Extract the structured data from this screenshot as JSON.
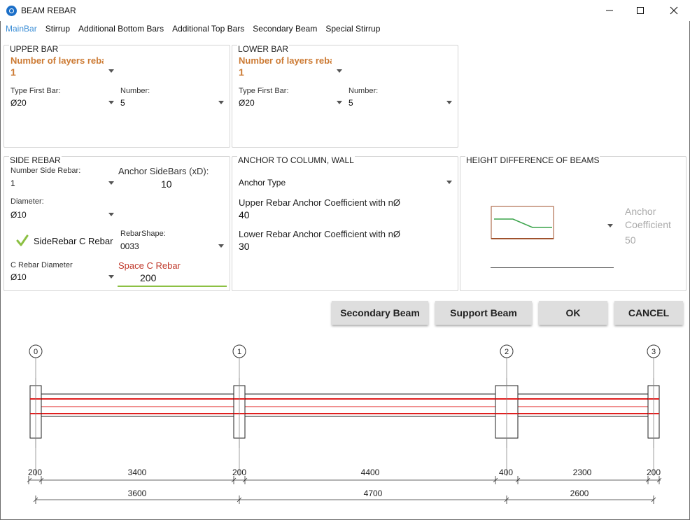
{
  "window": {
    "title": "BEAM REBAR",
    "minimize": "—",
    "maximize": "☐",
    "close": "✕"
  },
  "tabs": [
    "MainBar",
    "Stirrup",
    "Additional Bottom Bars",
    "Additional Top Bars",
    "Secondary Beam",
    "Special Stirrup"
  ],
  "upper_bar": {
    "title": "UPPER BAR",
    "layers_label": "Number of layers rebar",
    "layers_value": "1",
    "type_first_bar_label": "Type First Bar:",
    "type_first_bar_value": "Ø20",
    "number_label": "Number:",
    "number_value": "5"
  },
  "lower_bar": {
    "title": "LOWER BAR",
    "layers_label": "Number of layers rebar",
    "layers_value": "1",
    "type_first_bar_label": "Type First Bar:",
    "type_first_bar_value": "Ø20",
    "number_label": "Number:",
    "number_value": "5"
  },
  "side_rebar": {
    "title": "SIDE REBAR",
    "number_label": "Number Side Rebar:",
    "number_value": "1",
    "anchor_label": "Anchor SideBars (xD):",
    "anchor_value": "10",
    "diameter_label": "Diameter:",
    "diameter_value": "Ø10",
    "c_rebar_check_label": "SideRebar C Rebar",
    "c_rebar_checked": true,
    "shape_label": "RebarShape:",
    "shape_value": "0033",
    "c_diameter_label": "C Rebar Diameter",
    "c_diameter_value": "Ø10",
    "space_label": "Space C Rebar",
    "space_value": "200"
  },
  "anchor": {
    "title": "ANCHOR TO COLUMN, WALL",
    "type_label": "Anchor Type",
    "upper_label": "Upper Rebar Anchor Coefficient with nØ",
    "upper_value": "40",
    "lower_label": "Lower Rebar Anchor Coefficient with nØ",
    "lower_value": "30"
  },
  "height_diff": {
    "title": "HEIGHT DIFFERENCE OF BEAMS",
    "coef_label_1": "Anchor",
    "coef_label_2": "Coefficient",
    "coef_value": "50"
  },
  "buttons": {
    "secondary_beam": "Secondary Beam",
    "support_beam": "Support Beam",
    "ok": "OK",
    "cancel": "CANCEL"
  },
  "drawing": {
    "axes": [
      "0",
      "1",
      "2",
      "3"
    ],
    "column_widths": [
      "200",
      "200",
      "400",
      "200"
    ],
    "clear_spans": [
      "3400",
      "4400",
      "2300"
    ],
    "axis_spans": [
      "3600",
      "4700",
      "2600"
    ],
    "colors": {
      "rebar": "#e02020",
      "outline": "#222222",
      "green": "#3aa34a",
      "brown": "#a0522d"
    }
  }
}
